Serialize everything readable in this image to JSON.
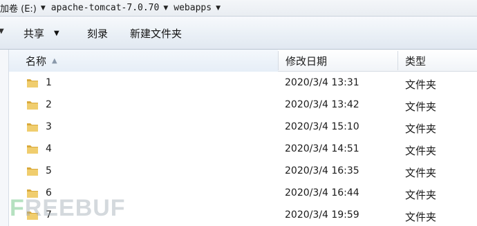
{
  "breadcrumb": {
    "items": [
      {
        "label": "加卷 (E:)"
      },
      {
        "label": "apache-tomcat-7.0.70"
      },
      {
        "label": "webapps"
      }
    ]
  },
  "toolbar": {
    "share_label": "共享",
    "burn_label": "刻录",
    "new_folder_label": "新建文件夹"
  },
  "columns": {
    "name": "名称",
    "date_modified": "修改日期",
    "type": "类型"
  },
  "files": [
    {
      "name": "1",
      "date": "2020/3/4 13:31",
      "type": "文件夹"
    },
    {
      "name": "2",
      "date": "2020/3/4 13:42",
      "type": "文件夹"
    },
    {
      "name": "3",
      "date": "2020/3/4 15:10",
      "type": "文件夹"
    },
    {
      "name": "4",
      "date": "2020/3/4 14:51",
      "type": "文件夹"
    },
    {
      "name": "5",
      "date": "2020/3/4 16:35",
      "type": "文件夹"
    },
    {
      "name": "6",
      "date": "2020/3/4 16:44",
      "type": "文件夹"
    },
    {
      "name": "7",
      "date": "2020/3/4 19:59",
      "type": "文件夹"
    }
  ],
  "icons": {
    "folder": "folder-icon",
    "breadcrumb_arrow": "chevron-down-icon",
    "sort": "sort-ascending-icon"
  },
  "watermark": {
    "first": "F",
    "rest": "REEBUF"
  },
  "colors": {
    "folder_fill": "#e9c46a",
    "folder_dark": "#c99a2e",
    "toolbar_top": "#f7f9fc",
    "toolbar_bottom": "#e1e8f1"
  }
}
